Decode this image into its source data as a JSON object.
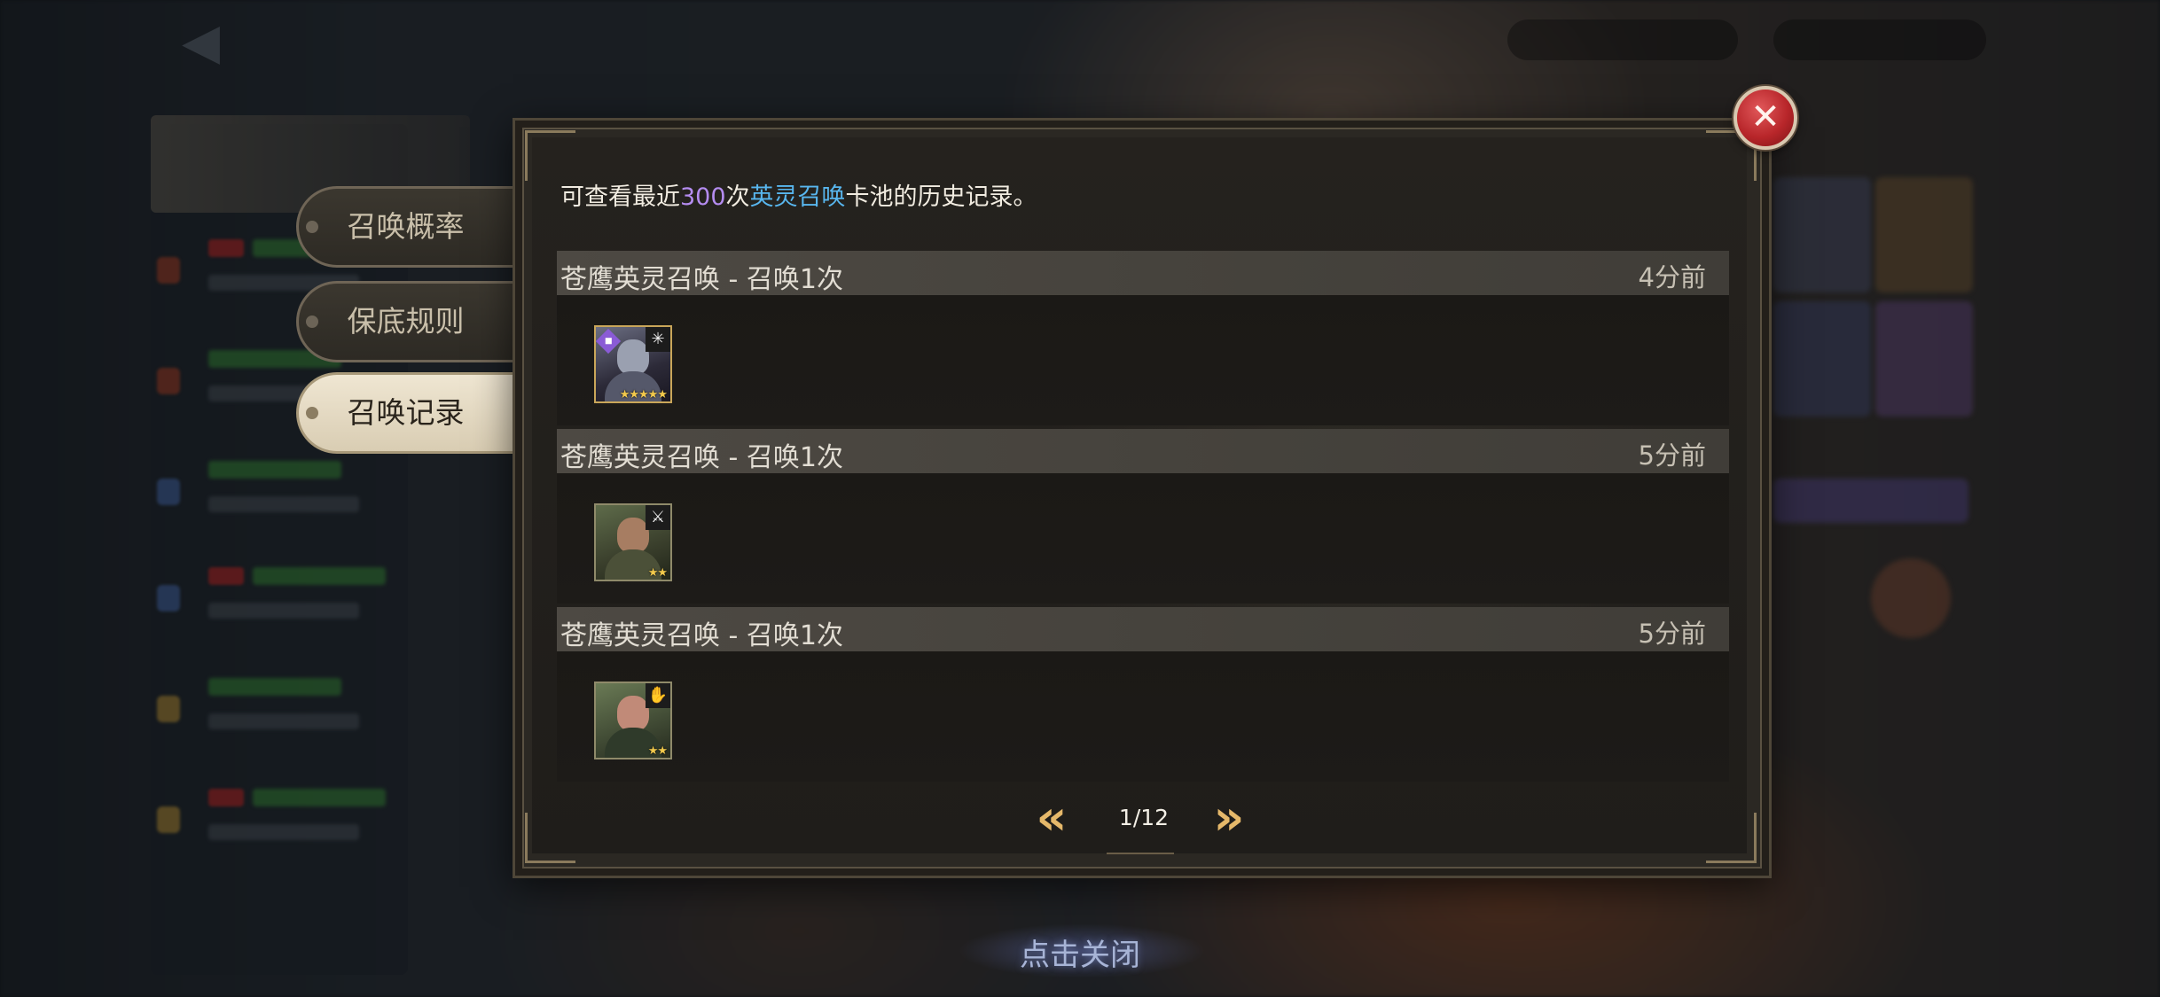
{
  "tabs": [
    {
      "label": "召唤概率",
      "active": false
    },
    {
      "label": "保底规则",
      "active": false
    },
    {
      "label": "召唤记录",
      "active": true
    }
  ],
  "intro": {
    "prefix": "可查看最近",
    "count": "300",
    "mid": "次",
    "pool": "英灵召唤",
    "suffix": "卡池的历史记录。"
  },
  "records": [
    {
      "title": "苍鹰英灵召唤 - 召唤1次",
      "time": "4分前",
      "hero": {
        "stars": "★★★★★",
        "class_icon": "sword-cross-icon",
        "rarity": 5
      }
    },
    {
      "title": "苍鹰英灵召唤 - 召唤1次",
      "time": "5分前",
      "hero": {
        "stars": "★★",
        "class_icon": "slash-icon",
        "rarity": 2
      }
    },
    {
      "title": "苍鹰英灵召唤 - 召唤1次",
      "time": "5分前",
      "hero": {
        "stars": "★★",
        "class_icon": "praying-hands-icon",
        "rarity": 2
      }
    }
  ],
  "pagination": {
    "text": "1/12",
    "prev_symbol": "«",
    "next_symbol": "»"
  },
  "close": {
    "symbol": "✕"
  },
  "dismiss_hint": "点击关闭",
  "colors": {
    "highlight_number": "#b48cf0",
    "highlight_pool": "#58b6ee",
    "close_red": "#b8262a",
    "pager_gold": "#e5b86a"
  }
}
